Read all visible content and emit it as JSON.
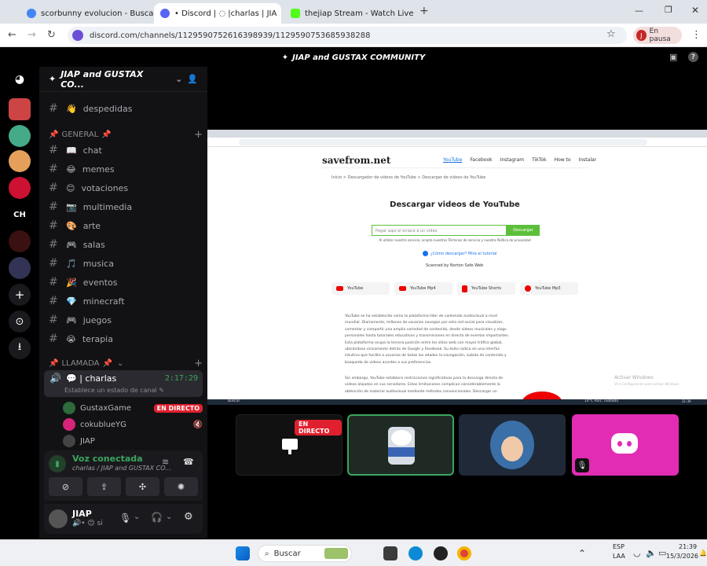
{
  "browser": {
    "tabs": [
      {
        "title": "scorbunny evolucion - Buscar c",
        "fav_color": "#4285f4"
      },
      {
        "title": "• Discord | ◌ |charlas | JIA",
        "fav_color": "#5865f2"
      },
      {
        "title": "thejiap Stream - Watch Live on",
        "fav_color": "#53fc18"
      }
    ],
    "new_tab": "+",
    "url": "discord.com/channels/1129590752616398939/1129590753685938288",
    "profile_letter": "J",
    "profile_label": "En pausa"
  },
  "discord": {
    "window_title": "JIAP and GUSTAX COMMUNITY",
    "server_name": "JIAP and GUSTAX CO...",
    "top_channel": "despedidas",
    "categories": {
      "general": "GENERAL",
      "llamada": "LLAMADA"
    },
    "channels": [
      {
        "name": "chat",
        "emoji": "📖"
      },
      {
        "name": "memes",
        "emoji": "😂"
      },
      {
        "name": "votaciones",
        "emoji": "😊"
      },
      {
        "name": "multimedia",
        "emoji": "📷"
      },
      {
        "name": "arte",
        "emoji": "🎨"
      },
      {
        "name": "salas",
        "emoji": "🎮"
      },
      {
        "name": "musica",
        "emoji": "🎵"
      },
      {
        "name": "eventos",
        "emoji": "🎉"
      },
      {
        "name": "minecraft",
        "emoji": "💎"
      },
      {
        "name": "juegos",
        "emoji": "🎮"
      },
      {
        "name": "terapia",
        "emoji": "😭"
      }
    ],
    "voice_channel": {
      "name": "charlas",
      "time": "2:17:29",
      "status": "Establece un estado de canal"
    },
    "voice_users": [
      {
        "name": "GustaxGame",
        "live": "EN DIRECTO"
      },
      {
        "name": "cokublueYG"
      },
      {
        "name": "JIAP"
      }
    ],
    "voice_panel": {
      "title": "Voz conectada",
      "subtitle": "charlas / JIAP and GUSTAX CO..."
    },
    "user": {
      "name": "JIAP",
      "status": "si"
    },
    "live_badge": "EN DIRECTO"
  },
  "shared_screen": {
    "site": "savefrom.net",
    "nav": [
      "YouTube",
      "Facebook",
      "Instagram",
      "TikTok",
      "How to",
      "Instalar"
    ],
    "breadcrumb": "Inicio  >  Descargador de videos de YouTube  >  Descargar de videos de YouTube",
    "heading": "Descargar videos de YouTube",
    "input_placeholder": "Pegar aquí el enlace a un video",
    "button": "Descargar",
    "terms": "Al utilizar nuestro servicio, acepta nuestros Términos de servicio y nuestra Política de privacidad",
    "how_to": "¿Cómo descargar? Mira el tutorial",
    "scanned": "Scanned by  Norton  Safe Web",
    "chips": [
      "YouTube",
      "YouTube Mp4",
      "YouTube Shorts",
      "YouTube Mp3"
    ],
    "paragraph1": "YouTube se ha establecido como la plataforma líder de contenido audiovisual a nivel mundial. Diariamente, millones de usuarios navegan por esta red social para visualizar, comentar y compartir una amplia variedad de contenido, desde videos musicales y vlogs personales hasta tutoriales educativos y transmisiones en directo de eventos importantes. Esta plataforma ocupa la tercera posición entre los sitios web con mayor tráfico global, ubicándose únicamente detrás de Google y Facebook. Su éxito radica en una interfaz intuitiva que facilita a usuarios de todas las edades la navegación, subida de contenido y búsqueda de videos acordes a sus preferencias.",
    "paragraph2": "Sin embargo, YouTube establece restricciones significativas para la descarga directa de videos alojados en sus servidores. Estas limitaciones complican considerablemente la obtención de material audiovisual mediante métodos convencionales. Descargar un",
    "watermark1": "Activar Windows",
    "watermark2": "Ve a Configuración para activar Windows.",
    "inner_taskbar_search": "Buscar",
    "inner_weather": "14°C  Parc. nublado",
    "inner_time": "21:39",
    "inner_date": "15/3/2026"
  },
  "taskbar": {
    "search": "Buscar",
    "lang1": "ESP",
    "lang2": "LAA",
    "time": "21:39",
    "date": "15/3/2026"
  }
}
